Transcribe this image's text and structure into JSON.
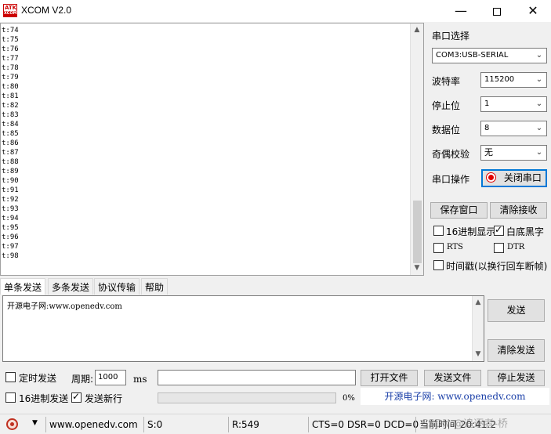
{
  "window": {
    "title": "XCOM V2.0",
    "logo_top": "ATK",
    "logo_bottom": "XCOM"
  },
  "receive": {
    "lines": [
      "t:74",
      "t:75",
      "t:76",
      "t:77",
      "t:78",
      "t:79",
      "t:80",
      "t:81",
      "t:82",
      "t:83",
      "t:84",
      "t:85",
      "t:86",
      "t:87",
      "t:88",
      "t:89",
      "t:90",
      "t:91",
      "t:92",
      "t:93",
      "t:94",
      "t:95",
      "t:96",
      "t:97",
      "t:98"
    ]
  },
  "serial": {
    "port_label": "串口选择",
    "port_value": "COM3:USB-SERIAL",
    "baud_label": "波特率",
    "baud_value": "115200",
    "stop_label": "停止位",
    "stop_value": "1",
    "data_label": "数据位",
    "data_value": "8",
    "parity_label": "奇偶校验",
    "parity_value": "无",
    "op_label": "串口操作",
    "toggle_button": "关闭串口",
    "save_window": "保存窗口",
    "clear_receive": "清除接收",
    "hex_display": "16进制显示",
    "white_bg": "白底黑字",
    "rts": "RTS",
    "dtr": "DTR",
    "timestamp": "时间戳(以换行回车断帧)"
  },
  "tabs": [
    "单条发送",
    "多条发送",
    "协议传输",
    "帮助"
  ],
  "send": {
    "text": "开源电子网:www.openedv.com",
    "send_button": "发送",
    "clear_send_button": "清除发送",
    "timed_send": "定时发送",
    "period_label": "周期:",
    "period_value": "1000",
    "period_unit": "ms",
    "open_file": "打开文件",
    "send_file": "发送文件",
    "stop_send": "停止发送",
    "hex_send": "16进制发送",
    "send_newline": "发送新行",
    "progress_text": "0%",
    "progress": 0,
    "banner": "开源电子网: www.openedv.com"
  },
  "status": {
    "url": "www.openedv.com",
    "sent": "S:0",
    "received": "R:549",
    "lines": "CTS=0 DSR=0 DCD=0",
    "time": "当前时间 20:41:2",
    "watermark": "CSDN @追逐者-桥"
  },
  "colors": {
    "accent": "#0078d7",
    "record": "#e00000"
  }
}
